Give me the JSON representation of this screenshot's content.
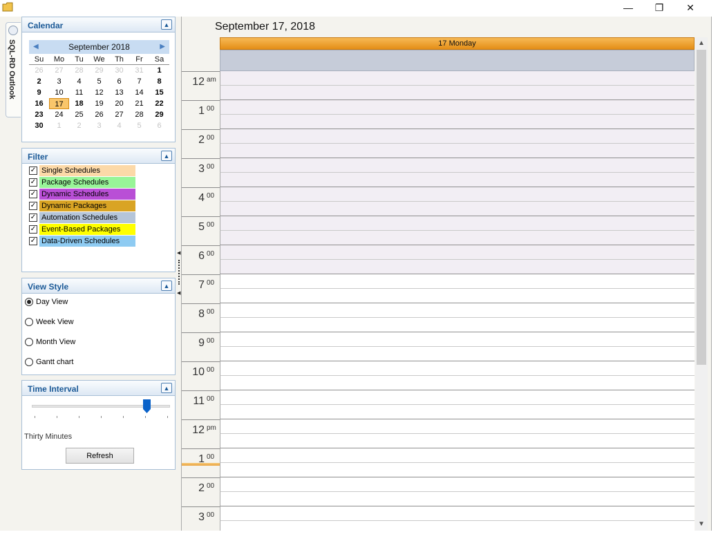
{
  "window": {
    "minimize_glyph": "—",
    "restore_glyph": "❐",
    "close_glyph": "✕",
    "icon": "folder-icon"
  },
  "side_tab": {
    "label": "SQL-RD Outlook",
    "icon": "clock-icon"
  },
  "calendar_panel": {
    "title": "Calendar",
    "month_label": "September 2018",
    "dow": [
      "Su",
      "Mo",
      "Tu",
      "We",
      "Th",
      "Fr",
      "Sa"
    ],
    "weeks": [
      [
        [
          "26",
          "muted"
        ],
        [
          "27",
          "muted"
        ],
        [
          "28",
          "muted"
        ],
        [
          "29",
          "muted"
        ],
        [
          "30",
          "muted"
        ],
        [
          "31",
          "muted"
        ],
        [
          "1",
          "bold"
        ]
      ],
      [
        [
          "2",
          "bold"
        ],
        [
          "3",
          ""
        ],
        [
          "4",
          ""
        ],
        [
          "5",
          ""
        ],
        [
          "6",
          ""
        ],
        [
          "7",
          ""
        ],
        [
          "8",
          "bold"
        ]
      ],
      [
        [
          "9",
          "bold"
        ],
        [
          "10",
          ""
        ],
        [
          "11",
          ""
        ],
        [
          "12",
          ""
        ],
        [
          "13",
          ""
        ],
        [
          "14",
          ""
        ],
        [
          "15",
          "bold"
        ]
      ],
      [
        [
          "16",
          "bold"
        ],
        [
          "17",
          "sel"
        ],
        [
          "18",
          "bold"
        ],
        [
          "19",
          ""
        ],
        [
          "20",
          ""
        ],
        [
          "21",
          ""
        ],
        [
          "22",
          "bold"
        ]
      ],
      [
        [
          "23",
          "bold"
        ],
        [
          "24",
          ""
        ],
        [
          "25",
          ""
        ],
        [
          "26",
          ""
        ],
        [
          "27",
          ""
        ],
        [
          "28",
          ""
        ],
        [
          "29",
          "bold"
        ]
      ],
      [
        [
          "30",
          "bold"
        ],
        [
          "1",
          "muted"
        ],
        [
          "2",
          "muted"
        ],
        [
          "3",
          "muted"
        ],
        [
          "4",
          "muted"
        ],
        [
          "5",
          "muted"
        ],
        [
          "6",
          "muted"
        ]
      ]
    ]
  },
  "filter_panel": {
    "title": "Filter",
    "items": [
      {
        "label": "Single Schedules",
        "color": "#fcd9a8",
        "checked": true
      },
      {
        "label": "Package Schedules",
        "color": "#98f598",
        "checked": true
      },
      {
        "label": "Dynamic Schedules",
        "color": "#b94fd6",
        "checked": true
      },
      {
        "label": "Dynamic Packages",
        "color": "#d9a424",
        "checked": true
      },
      {
        "label": "Automation Schedules",
        "color": "#b5c5d9",
        "checked": true
      },
      {
        "label": "Event-Based Packages",
        "color": "#ffff00",
        "checked": true
      },
      {
        "label": "Data-Driven Schedules",
        "color": "#8ecbf2",
        "checked": true
      }
    ]
  },
  "view_style_panel": {
    "title": "View Style",
    "options": [
      {
        "label": "Day View",
        "selected": true
      },
      {
        "label": "Week View",
        "selected": false
      },
      {
        "label": "Month View",
        "selected": false
      },
      {
        "label": "Gantt chart",
        "selected": false
      }
    ]
  },
  "time_interval_panel": {
    "title": "Time Interval",
    "interval_label": "Thirty Minutes",
    "slider_value_fraction": 0.83,
    "refresh_label": "Refresh"
  },
  "day_view": {
    "date_title": "September 17, 2018",
    "day_header": "17  Monday",
    "hours": [
      {
        "num": "12",
        "sup": "am"
      },
      {
        "num": "1",
        "sup": "00"
      },
      {
        "num": "2",
        "sup": "00"
      },
      {
        "num": "3",
        "sup": "00"
      },
      {
        "num": "4",
        "sup": "00"
      },
      {
        "num": "5",
        "sup": "00"
      },
      {
        "num": "6",
        "sup": "00"
      },
      {
        "num": "7",
        "sup": "00"
      },
      {
        "num": "8",
        "sup": "00"
      },
      {
        "num": "9",
        "sup": "00"
      },
      {
        "num": "10",
        "sup": "00"
      },
      {
        "num": "11",
        "sup": "00"
      },
      {
        "num": "12",
        "sup": "pm"
      },
      {
        "num": "1",
        "sup": "00"
      },
      {
        "num": "2",
        "sup": "00"
      },
      {
        "num": "3",
        "sup": "00"
      }
    ],
    "work_start_hour_index": 7,
    "current_time_hour_index": 13
  }
}
